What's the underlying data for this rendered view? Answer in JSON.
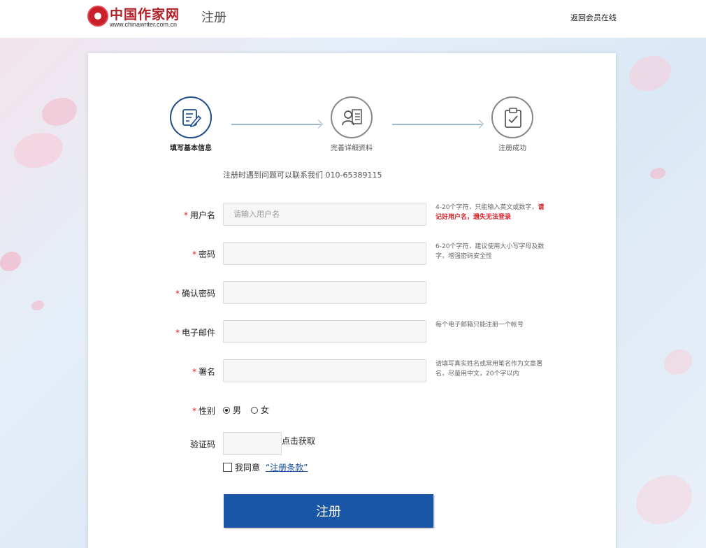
{
  "header": {
    "logo_text": "中国作家网",
    "logo_url": "www.chinawriter.com.cn",
    "title": "注册",
    "back_link": "返回会员在线"
  },
  "steps": [
    {
      "label": "填写基本信息",
      "icon": "edit-document-icon",
      "active": true
    },
    {
      "label": "完善详细资料",
      "icon": "profile-card-icon",
      "active": false
    },
    {
      "label": "注册成功",
      "icon": "clipboard-check-icon",
      "active": false
    }
  ],
  "contact_text": "注册时遇到问题可以联系我们 010-65389115",
  "form": {
    "required_mark": "*",
    "username": {
      "label": "用户名",
      "placeholder": "请输入用户名",
      "hint": "4-20个字符，只能输入英文或数字，",
      "hint_warning": "请记好用户名，遗失无法登录"
    },
    "password": {
      "label": "密码",
      "hint": "6-20个字符，建议使用大小写字母及数字，增强密码安全性"
    },
    "confirm_password": {
      "label": "确认密码"
    },
    "email": {
      "label": "电子邮件",
      "hint": "每个电子邮箱只能注册一个帐号"
    },
    "pen_name": {
      "label": "署名",
      "hint": "请填写真实姓名或常用笔名作为文章署名，尽量用中文，20个字以内"
    },
    "gender": {
      "label": "性别",
      "options": [
        "男",
        "女"
      ],
      "selected": "男"
    },
    "captcha": {
      "label": "验证码",
      "button": "点击获取"
    },
    "agree": {
      "text": "我同意",
      "terms": "“注册条款”",
      "checked": false
    },
    "submit": "注册"
  },
  "colors": {
    "accent": "#1a56a6",
    "required": "#d9262c",
    "brand": "#b11e25"
  }
}
